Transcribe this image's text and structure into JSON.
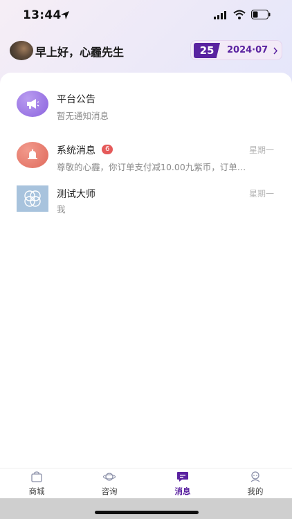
{
  "status_bar": {
    "time": "13:44"
  },
  "header": {
    "greeting": "早上好，心霾先生",
    "date_day": "25",
    "date_month": "2024·07"
  },
  "messages": [
    {
      "title": "平台公告",
      "subtitle": "暂无通知消息",
      "time": "",
      "icon": "megaphone-icon",
      "icon_color": "#9a7ae0"
    },
    {
      "title": "系统消息",
      "badge": "6",
      "subtitle": "尊敬的心霾，你订单支付减10.00九紫币，订单…",
      "time": "星期一",
      "icon": "bell-icon",
      "icon_color": "#e8786a"
    },
    {
      "title": "测试大师",
      "subtitle": "我",
      "time": "星期一",
      "icon": "circles-logo-icon",
      "icon_color": "#9ab9d6"
    }
  ],
  "tabs": [
    {
      "label": "商城",
      "icon": "bag-icon"
    },
    {
      "label": "咨询",
      "icon": "planet-icon"
    },
    {
      "label": "消息",
      "icon": "message-icon",
      "active": true
    },
    {
      "label": "我的",
      "icon": "profile-icon"
    }
  ],
  "colors": {
    "accent": "#5a22a0",
    "badge": "#e55a5a"
  }
}
